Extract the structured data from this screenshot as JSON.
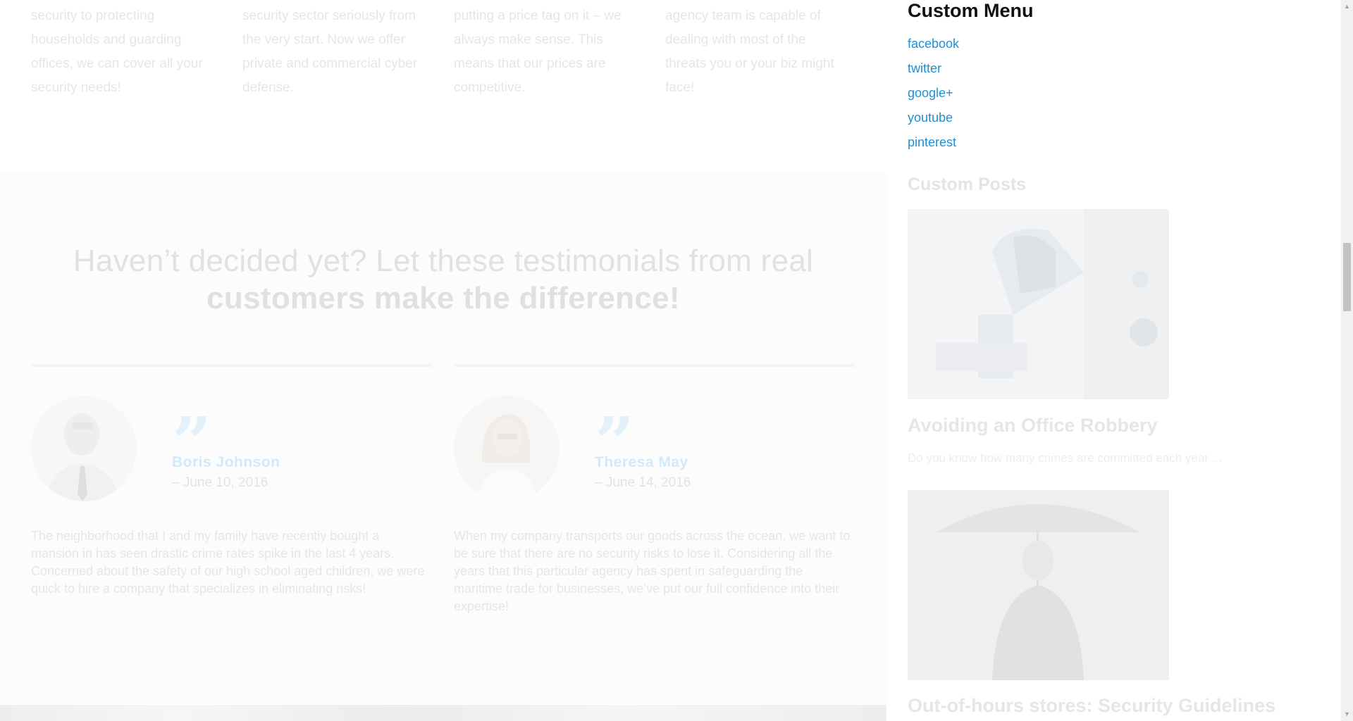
{
  "features": [
    {
      "text": "security to protecting households and guarding offices, we can cover all your security needs!"
    },
    {
      "text": "security sector seriously from the very start. Now we offer private and commercial cyber defense."
    },
    {
      "text": "putting a price tag on it – we always make sense. This means that our prices are competitive."
    },
    {
      "text": "agency team is capable of dealing with most of the threats you or your biz might face!"
    }
  ],
  "testimonials": {
    "headline_light": "Haven’t decided yet? Let these testimonials from real",
    "headline_bold": "customers make the difference!",
    "items": [
      {
        "name": "Boris Johnson",
        "date": "– June 10, 2016",
        "body": "The neighborhood that I and my family have recently bought a mansion in has seen drastic crime rates spike in the last 4 years. Concerned about the safety of our high school aged children, we were quick to hire a company that specializes in eliminating risks!",
        "quote_mark": "”"
      },
      {
        "name": "Theresa May",
        "date": "– June 14, 2016",
        "body": "When my company transports our goods across the ocean, we want to be sure that there are no security risks to lose it. Considering all the years that this particular agency has spent in safeguarding the maritime trade for businesses, we’ve put our full confidence into their expertise!",
        "quote_mark": "”"
      }
    ]
  },
  "sidebar": {
    "menu_title": "Custom Menu",
    "menu_items": [
      "facebook",
      "twitter",
      "google+",
      "youtube",
      "pinterest"
    ],
    "posts_title": "Custom Posts",
    "posts": [
      {
        "title": "Avoiding an Office Robbery",
        "excerpt": "Do you know how many crimes are committed each year ..."
      },
      {
        "title": "Out-of-hours stores: Security Guidelines",
        "excerpt": ""
      }
    ]
  },
  "colors": {
    "link": "#1e90d6",
    "accent_faded": "#d2e9f8",
    "widget_title": "#111111"
  }
}
